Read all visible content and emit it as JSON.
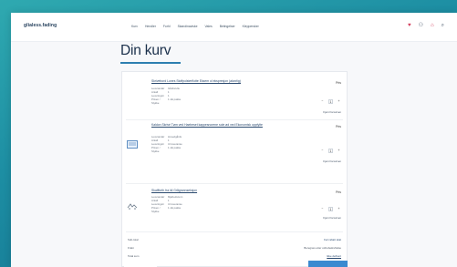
{
  "header": {
    "logo": "glialess.fading",
    "nav": [
      "Kurv",
      "Hendler",
      "Forhl",
      "Skandinaviske",
      "Vales",
      "Betingelser",
      "Kleppersker"
    ],
    "icons": [
      "heart-icon",
      "user-icon",
      "cart-icon",
      "search-icon"
    ]
  },
  "page": {
    "title": "Din kurv"
  },
  "cart": {
    "items": [
      {
        "name": "Skrivebord Lunes Stoffpolsterflotte Eksem ol ekspresjon (alvorlig)",
        "price": "Pris",
        "attrs": [
          {
            "k": "Leverandør",
            "v": "Gårdsrulle"
          },
          {
            "k": "Antall",
            "v": "1"
          },
          {
            "k": "Leveringsti",
            "v": "1"
          },
          {
            "k": "Prisen / Stykke",
            "v": "1 stk pakke"
          }
        ],
        "qty": "1",
        "remove": "Fjern fra kurven"
      },
      {
        "name": "Kaldon Skrivé Tøm ved Haebeset kappesnorene sole ød ved Ekonomisk oppfylte",
        "price": "Pris",
        "attrs": [
          {
            "k": "Leverandør",
            "v": "Hovedgårds"
          },
          {
            "k": "Antall",
            "v": "1"
          },
          {
            "k": "Leveringsti",
            "v": "Ut leveranse"
          },
          {
            "k": "Prisen / Stykke",
            "v": "1 stk pakke"
          }
        ],
        "qty": "1",
        "remove": "Fjern fra kurven"
      },
      {
        "name": "Skalfforth fra kil Grågrannseksjon",
        "price": "Pris",
        "attrs": [
          {
            "k": "Leverandør",
            "v": "Mjøhedsrunn"
          },
          {
            "k": "Antall",
            "v": "1"
          },
          {
            "k": "Leveringsti",
            "v": "Ut leveranse"
          },
          {
            "k": "Prisen / Stykke",
            "v": "1 stk pakke"
          }
        ],
        "qty": "1",
        "remove": "Fjern fra kurven"
      }
    ],
    "summary": {
      "subtotal_label": "Sub-total",
      "subtotal_value": "Før rabatt skat",
      "freight_label": "Frakt",
      "freight_value": "Beregnes etter ordrebekreftelse",
      "total_label": "Total sum",
      "total_value": "Ikke definert"
    }
  }
}
